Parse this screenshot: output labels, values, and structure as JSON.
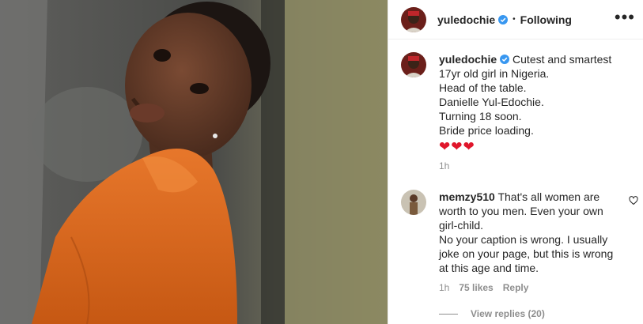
{
  "post": {
    "username": "yuledochie",
    "follow_status": "Following",
    "more_label": "•••",
    "caption_lines": [
      "Cutest and smartest",
      "17yr old girl in Nigeria.",
      "Head of the table.",
      "Danielle Yul-Edochie.",
      "Turning 18 soon.",
      "Bride price loading."
    ],
    "hearts": "❤❤❤",
    "time": "1h"
  },
  "comment": {
    "username": "memzy510",
    "lines": [
      "That's all women are",
      "worth to you men. Even your own",
      "girl-child.",
      "No your caption is wrong. I usually",
      "joke on your page, but this is wrong",
      "at this age and time."
    ],
    "time": "1h",
    "likes": "75 likes",
    "reply_label": "Reply",
    "view_replies": "View replies (20)"
  },
  "colors": {
    "verified_blue": "#3897f0",
    "heart_red": "#e0162b",
    "secondary_text": "#8e8e8e",
    "orange_top": "#e06a1c"
  },
  "icons": {
    "verified": "verified-badge-icon",
    "like": "heart-outline-icon",
    "more": "more-options-icon"
  }
}
